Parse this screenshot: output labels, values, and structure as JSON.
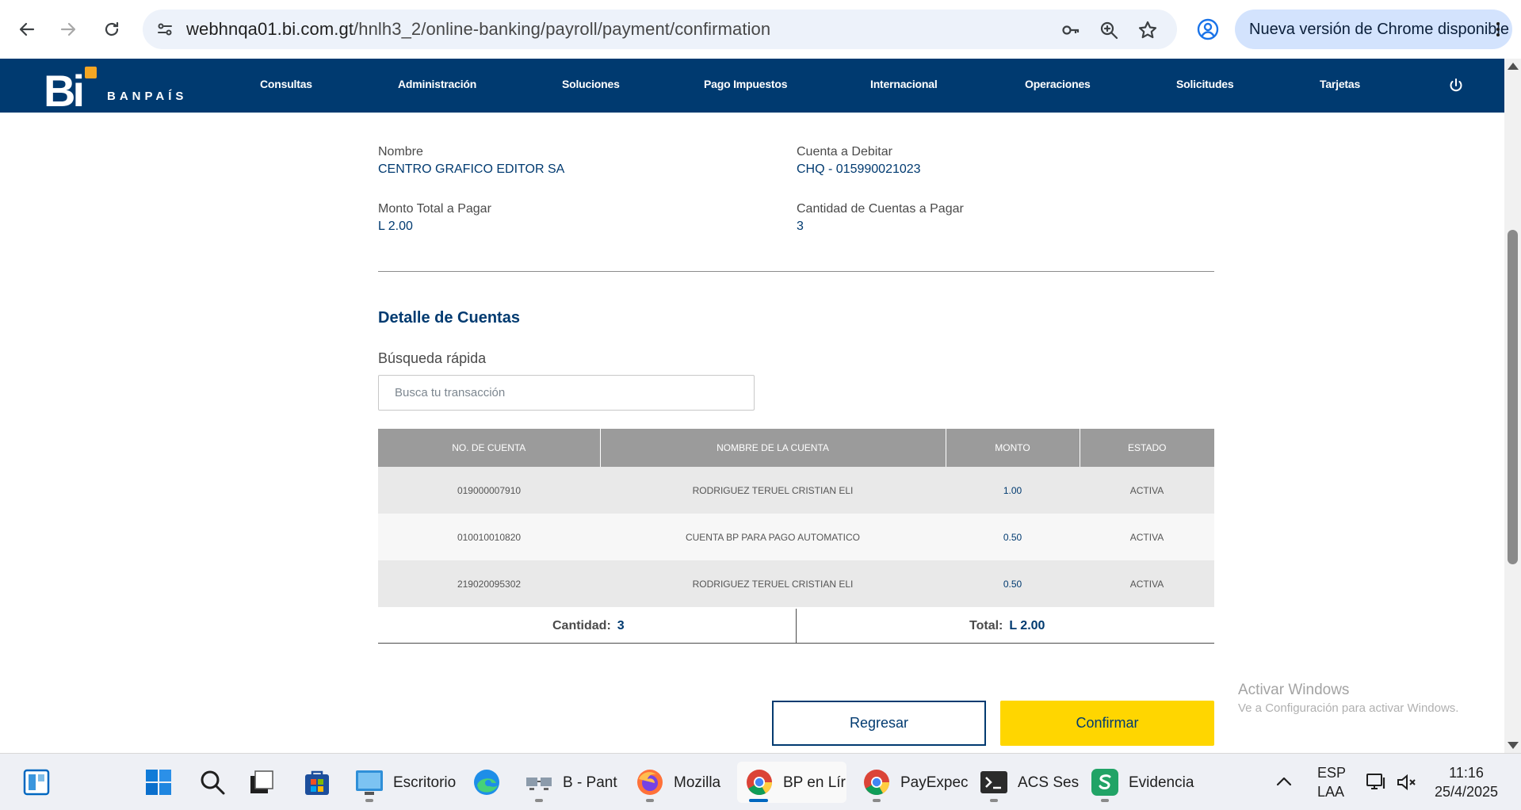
{
  "browser": {
    "url_host": "webhnqa01.bi.com.gt",
    "url_path": "/hnlh3_2/online-banking/payroll/payment/confirmation",
    "update_label": "Nueva versión de Chrome disponible"
  },
  "bank": {
    "logo_mark": "Bi",
    "logo_word": "BANPAÍS",
    "menu": [
      "Consultas",
      "Administración",
      "Soluciones",
      "Pago Impuestos",
      "Internacional",
      "Operaciones",
      "Solicitudes",
      "Tarjetas"
    ]
  },
  "summary_info": {
    "nombre_label": "Nombre",
    "nombre_value": "CENTRO GRAFICO EDITOR SA",
    "cuenta_label": "Cuenta a Debitar",
    "cuenta_value": "CHQ - 015990021023",
    "monto_label": "Monto Total a Pagar",
    "monto_value": "L 2.00",
    "cantidad_label": "Cantidad de Cuentas a Pagar",
    "cantidad_value": "3"
  },
  "detail": {
    "title": "Detalle de Cuentas",
    "search_label": "Búsqueda rápida",
    "search_placeholder": "Busca tu transacción",
    "columns": [
      "NO. DE CUENTA",
      "NOMBRE DE LA CUENTA",
      "MONTO",
      "ESTADO"
    ],
    "rows": [
      [
        "019000007910",
        "RODRIGUEZ TERUEL CRISTIAN ELI",
        "1.00",
        "ACTIVA"
      ],
      [
        "010010010820",
        "CUENTA BP PARA PAGO AUTOMATICO",
        "0.50",
        "ACTIVA"
      ],
      [
        "219020095302",
        "RODRIGUEZ TERUEL CRISTIAN ELI",
        "0.50",
        "ACTIVA"
      ]
    ],
    "cantidad_label": "Cantidad:",
    "cantidad_value": "3",
    "total_label": "Total:",
    "total_value": "L 2.00"
  },
  "actions": {
    "back_label": "Regresar",
    "confirm_label": "Confirmar"
  },
  "watermark": {
    "title": "Activar Windows",
    "subtitle": "Ve a Configuración para activar Windows."
  },
  "taskbar": {
    "apps": [
      {
        "label": "Escritorio",
        "icon": "desktop-icon"
      },
      {
        "label": "",
        "icon": "edge-icon"
      },
      {
        "label": "B - Pant",
        "icon": "network-app-icon"
      },
      {
        "label": "Mozilla",
        "icon": "firefox-icon"
      },
      {
        "label": "BP en Lír",
        "icon": "chrome-icon"
      },
      {
        "label": "PayExpec",
        "icon": "chrome-icon"
      },
      {
        "label": "ACS Ses",
        "icon": "terminal-icon"
      },
      {
        "label": "Evidencia",
        "icon": "green-app-icon"
      }
    ],
    "lang_top": "ESP",
    "lang_bottom": "LAA",
    "time": "11:16",
    "date": "25/4/2025"
  },
  "colors": {
    "brand_navy": "#003a70",
    "accent_yellow": "#ffd600",
    "logo_orange": "#f5a623",
    "table_header": "#9b9b9b"
  }
}
